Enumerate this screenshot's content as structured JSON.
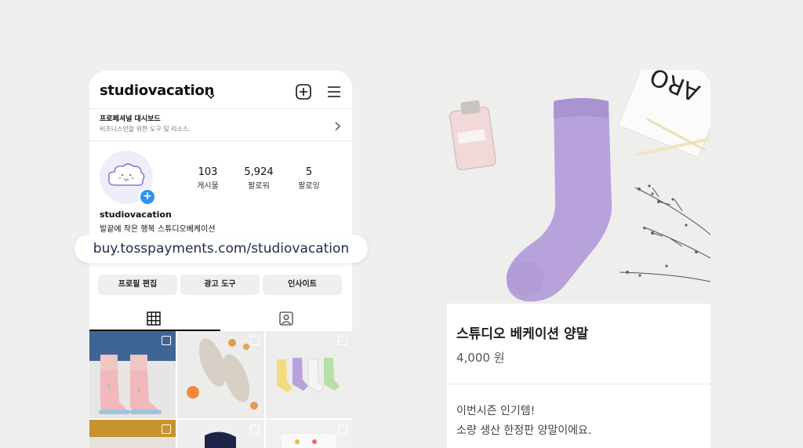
{
  "instagram": {
    "username": "studiovacation",
    "pro_dashboard": {
      "title": "프로페셔널 대시보드",
      "subtitle": "비즈니스만을 위한 도구 및 리소스."
    },
    "stats": [
      {
        "value": "103",
        "label": "게시물"
      },
      {
        "value": "5,924",
        "label": "팔로워"
      },
      {
        "value": "5",
        "label": "팔로잉"
      }
    ],
    "profile_name": "studiovacation",
    "bio": "발끝에 작은 행복 스튜디오베케이션",
    "buttons": [
      "프로필 편집",
      "광고 도구",
      "인사이트"
    ],
    "icons": [
      "chevron-down-icon",
      "add-post-icon",
      "menu-icon",
      "chevron-right-icon",
      "grid-icon",
      "tagged-icon",
      "cloud-mascot-icon"
    ]
  },
  "link": "buy.tosspayments.com/studiovacation",
  "product": {
    "name": "스튜디오 베케이션 양말",
    "price": "4,000 원",
    "description_line1": "이번시즌 인기템!",
    "description_line2": "소량 생산 한정판 양말이에요."
  },
  "colors": {
    "background": "#efefef",
    "accent_blue": "#2a92f0",
    "sock_lavender": "#b8a2dc",
    "link_text": "#1e2a4a"
  }
}
